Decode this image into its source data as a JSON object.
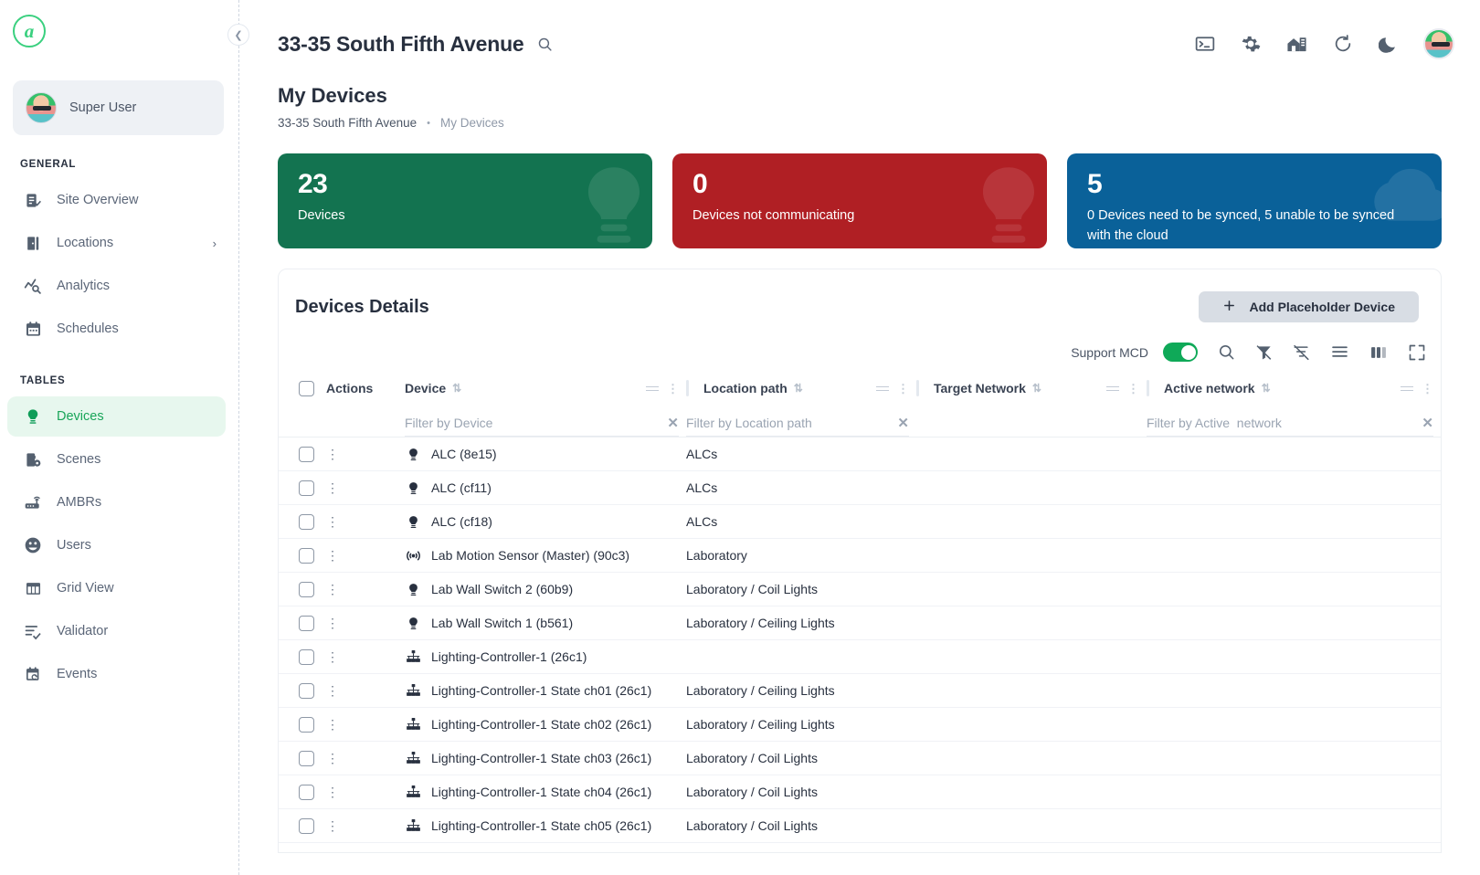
{
  "brand": {
    "logo_letter": "a"
  },
  "sidebar": {
    "user": {
      "name": "Super User",
      "avatar": "user-avatar"
    },
    "sections": [
      {
        "label": "GENERAL",
        "items": [
          {
            "label": "Site Overview",
            "icon": "clipboard-check-icon",
            "active": false,
            "chevron": ""
          },
          {
            "label": "Locations",
            "icon": "door-icon",
            "active": false,
            "chevron": "›"
          },
          {
            "label": "Analytics",
            "icon": "analytics-icon",
            "active": false,
            "chevron": ""
          },
          {
            "label": "Schedules",
            "icon": "calendar-icon",
            "active": false,
            "chevron": ""
          }
        ]
      },
      {
        "label": "TABLES",
        "items": [
          {
            "label": "Devices",
            "icon": "bulb-icon",
            "active": true,
            "chevron": ""
          },
          {
            "label": "Scenes",
            "icon": "scene-icon",
            "active": false,
            "chevron": ""
          },
          {
            "label": "AMBRs",
            "icon": "router-icon",
            "active": false,
            "chevron": ""
          },
          {
            "label": "Users",
            "icon": "users-icon",
            "active": false,
            "chevron": ""
          },
          {
            "label": "Grid View",
            "icon": "grid-icon",
            "active": false,
            "chevron": ""
          },
          {
            "label": "Validator",
            "icon": "validator-icon",
            "active": false,
            "chevron": ""
          },
          {
            "label": "Events",
            "icon": "event-history-icon",
            "active": false,
            "chevron": ""
          }
        ]
      }
    ]
  },
  "header": {
    "site_title": "33-35 South Fifth Avenue",
    "search_icon": "search-icon",
    "icons": [
      {
        "name": "terminal-icon"
      },
      {
        "name": "gear-icon"
      },
      {
        "name": "building-icon"
      },
      {
        "name": "refresh-icon"
      },
      {
        "name": "moon-icon"
      }
    ]
  },
  "page": {
    "title": "My Devices",
    "breadcrumb": {
      "root": "33-35 South Fifth Avenue",
      "separator": "•",
      "current": "My Devices"
    }
  },
  "cards": [
    {
      "value": "23",
      "label": "Devices",
      "color": "#137350",
      "style": "green",
      "watermark": "bulb-icon"
    },
    {
      "value": "0",
      "label": "Devices not communicating",
      "color": "#b01f24",
      "style": "red",
      "watermark": "bulb-icon"
    },
    {
      "value": "5",
      "label": "0 Devices need to be synced, 5 unable to be synced with the cloud",
      "color": "#0a6199",
      "style": "blue",
      "watermark": "cloud-sync-icon"
    }
  ],
  "panel": {
    "title": "Devices Details",
    "add_button": {
      "label": "Add Placeholder Device",
      "icon": "plus-icon"
    },
    "toolbar": {
      "mcd_label": "Support MCD",
      "mcd_on": true,
      "icons": [
        {
          "name": "search-icon"
        },
        {
          "name": "filter-off-icon"
        },
        {
          "name": "clear-filters-icon"
        },
        {
          "name": "rows-density-icon"
        },
        {
          "name": "columns-icon"
        },
        {
          "name": "fullscreen-icon"
        }
      ]
    },
    "table": {
      "select_all": "select-all-checkbox",
      "columns": [
        {
          "key": "actions",
          "label": "Actions",
          "sortable": false,
          "filter": null
        },
        {
          "key": "device",
          "label": "Device",
          "sortable": true,
          "filter": "Filter by Device"
        },
        {
          "key": "location_path",
          "label": "Location path",
          "sortable": true,
          "filter": "Filter by Location path"
        },
        {
          "key": "target_network",
          "label": "Target Network",
          "sortable": true,
          "filter": null
        },
        {
          "key": "active_network",
          "label": "Active network",
          "sortable": true,
          "filter": "Filter by Active  network"
        }
      ],
      "rows": [
        {
          "icon": "bulb-icon",
          "device": "ALC (8e15)",
          "location_path": "ALCs",
          "target_network": "",
          "active_network": ""
        },
        {
          "icon": "bulb-icon",
          "device": "ALC (cf11)",
          "location_path": "ALCs",
          "target_network": "",
          "active_network": ""
        },
        {
          "icon": "bulb-icon",
          "device": "ALC (cf18)",
          "location_path": "ALCs",
          "target_network": "",
          "active_network": ""
        },
        {
          "icon": "motion-sensor-icon",
          "device": "Lab Motion Sensor (Master) (90c3)",
          "location_path": "Laboratory",
          "target_network": "",
          "active_network": ""
        },
        {
          "icon": "bulb-icon",
          "device": "Lab Wall Switch 2 (60b9)",
          "location_path": "Laboratory / Coil Lights",
          "target_network": "",
          "active_network": ""
        },
        {
          "icon": "bulb-icon",
          "device": "Lab Wall Switch 1 (b561)",
          "location_path": "Laboratory / Ceiling Lights",
          "target_network": "",
          "active_network": ""
        },
        {
          "icon": "controller-icon",
          "device": "Lighting-Controller-1 (26c1)",
          "location_path": "",
          "target_network": "",
          "active_network": ""
        },
        {
          "icon": "controller-icon",
          "device": "Lighting-Controller-1 State ch01 (26c1)",
          "location_path": "Laboratory / Ceiling Lights",
          "target_network": "",
          "active_network": ""
        },
        {
          "icon": "controller-icon",
          "device": "Lighting-Controller-1 State ch02 (26c1)",
          "location_path": "Laboratory / Ceiling Lights",
          "target_network": "",
          "active_network": ""
        },
        {
          "icon": "controller-icon",
          "device": "Lighting-Controller-1 State ch03 (26c1)",
          "location_path": "Laboratory / Coil Lights",
          "target_network": "",
          "active_network": ""
        },
        {
          "icon": "controller-icon",
          "device": "Lighting-Controller-1 State ch04 (26c1)",
          "location_path": "Laboratory / Coil Lights",
          "target_network": "",
          "active_network": ""
        },
        {
          "icon": "controller-icon",
          "device": "Lighting-Controller-1 State ch05 (26c1)",
          "location_path": "Laboratory / Coil Lights",
          "target_network": "",
          "active_network": ""
        }
      ]
    }
  },
  "colors": {
    "accent_green": "#0fa958",
    "card_green": "#137350",
    "card_red": "#b01f24",
    "card_blue": "#0a6199",
    "active_nav_bg": "#e7f7ee"
  }
}
